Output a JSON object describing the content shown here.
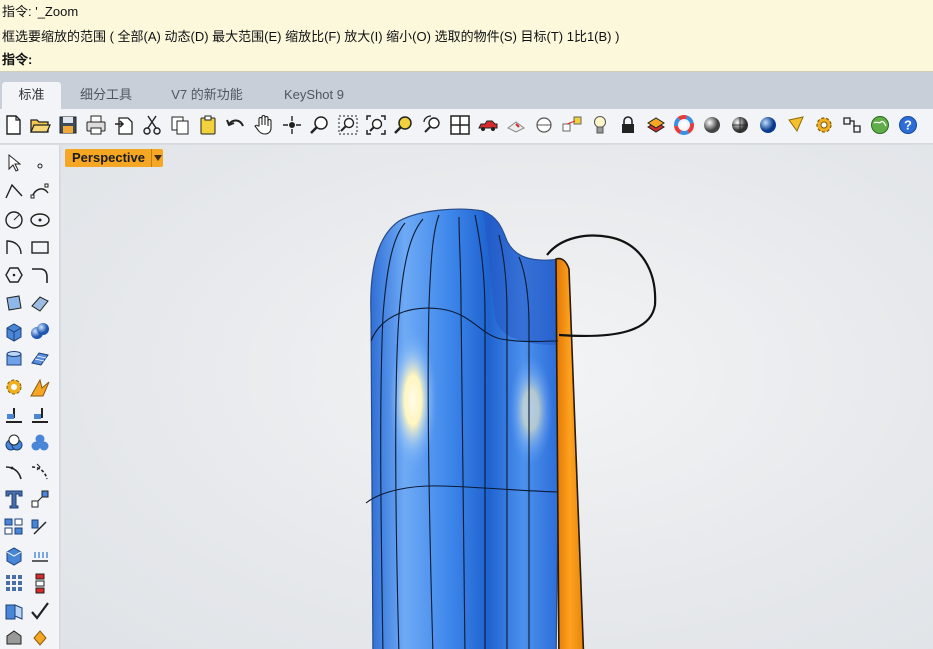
{
  "command": {
    "history_line_1": "指令: '_Zoom",
    "history_line_2": "框选要缩放的范围 ( 全部(A)  动态(D)  最大范围(E)  缩放比(F)  放大(I)  缩小(O)  选取的物件(S)  目标(T)  1比1(B) )",
    "prompt_label": "指令:",
    "input_value": ""
  },
  "tabs": [
    {
      "label": "标准",
      "active": true
    },
    {
      "label": "细分工具",
      "active": false
    },
    {
      "label": "V7 的新功能",
      "active": false
    },
    {
      "label": "KeyShot 9",
      "active": false
    }
  ],
  "toolbar_icons": [
    "new-file-icon",
    "open-folder-icon",
    "save-icon",
    "print-icon",
    "import-icon",
    "cut-icon",
    "copy-icon",
    "paste-icon",
    "undo-icon",
    "pan-hand-icon",
    "rotate-view-icon",
    "zoom-icon",
    "zoom-window-icon",
    "zoom-extents-icon",
    "zoom-selected-icon",
    "rotate-camera-icon",
    "four-viewports-icon",
    "car-icon",
    "named-views-icon",
    "cplane-icon",
    "set-target-icon",
    "light-bulb-icon",
    "lock-icon",
    "layers-icon",
    "color-wheel-icon",
    "shaded-sphere-icon",
    "rendered-sphere-icon",
    "blue-sphere-icon",
    "render-light-icon",
    "settings-gear-icon",
    "options-icon",
    "globe-icon",
    "help-icon"
  ],
  "sidebar_icons": [
    "select-arrow-icon",
    "point-icon",
    "polyline-icon",
    "curve-cv-icon",
    "circle-icon",
    "ellipse-icon",
    "arc-icon",
    "rectangle-icon",
    "polygon-icon",
    "fillet-curve-icon",
    "surface-corners-icon",
    "extrude-surface-icon",
    "box-solid-icon",
    "sphere-solid-icon",
    "cylinder-icon",
    "mesh-plane-icon",
    "explode-icon",
    "boolean-icon",
    "trim-icon",
    "split-icon",
    "boolean-union-icon",
    "boolean-split-icon",
    "fillet-edge-icon",
    "chamfer-icon",
    "text-icon",
    "scale-icon",
    "array-icon",
    "gumball-icon",
    "box-edit-icon",
    "dimension-icon",
    "grid-icon",
    "object-align-icon",
    "layout-icon",
    "check-mark-icon",
    "solid-cube-icon",
    "sun-icon"
  ],
  "viewport": {
    "label": "Perspective"
  },
  "colors": {
    "accent": "#f5a623",
    "surface_blue": "#3f8ff0",
    "surface_orange": "#f28c0a",
    "command_bg": "#fbf8dc"
  }
}
